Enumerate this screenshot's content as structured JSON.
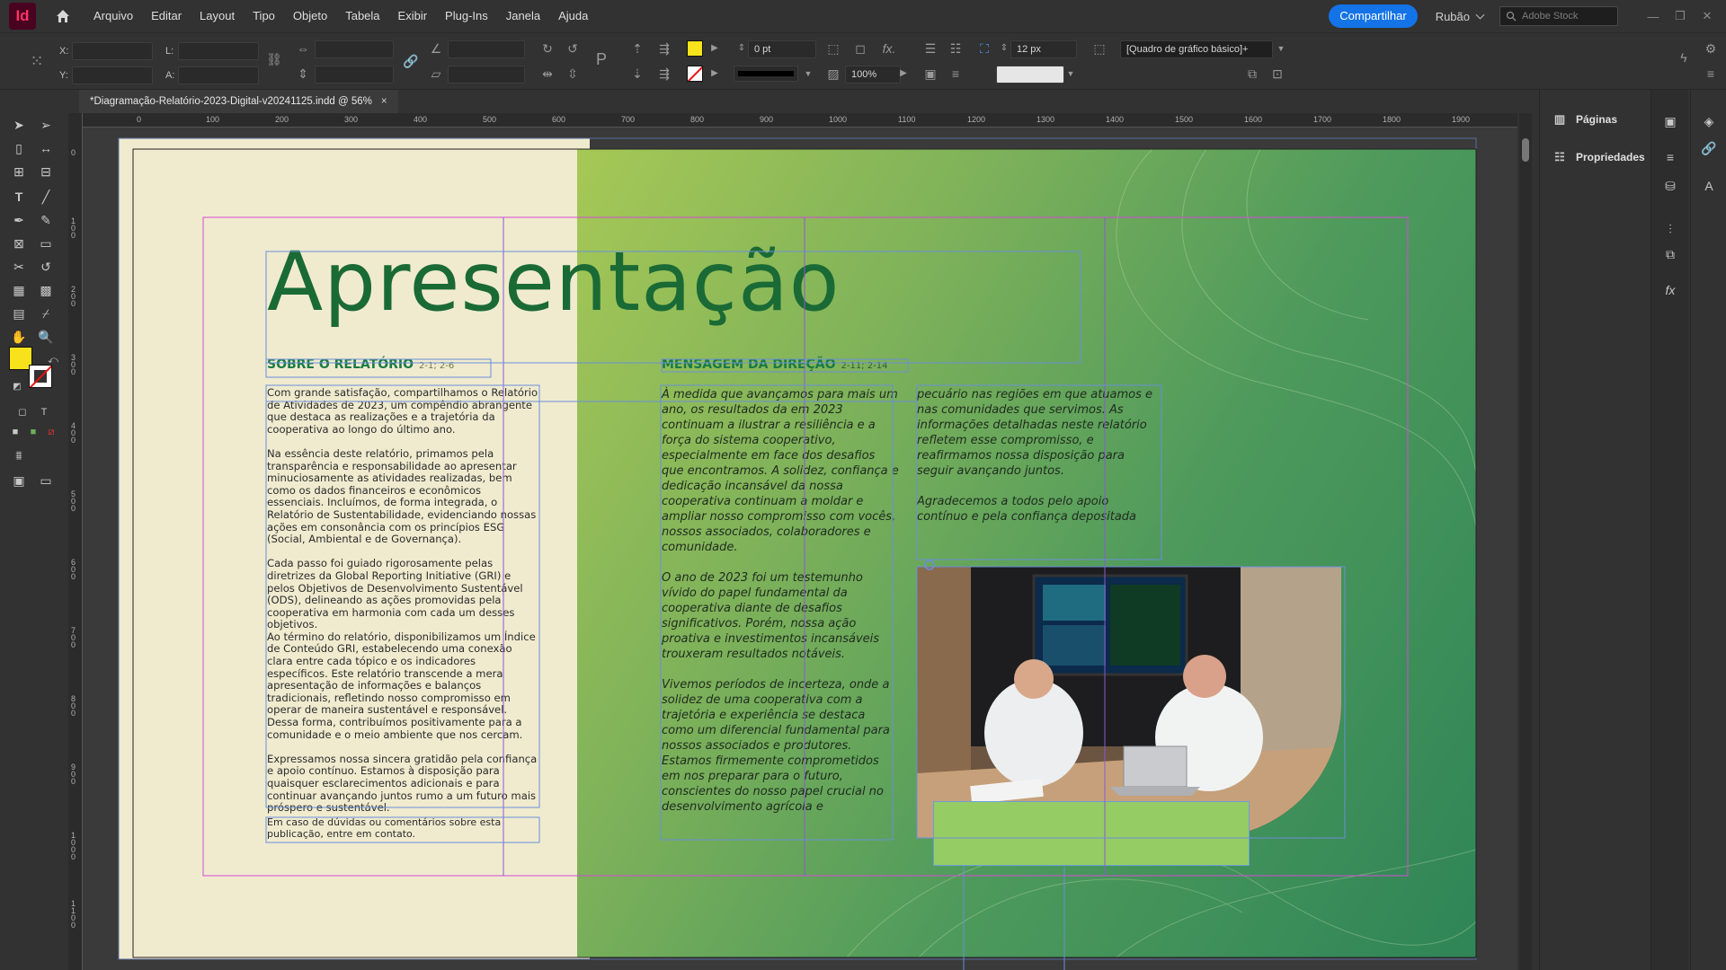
{
  "app": {
    "logo": "Id",
    "menus": [
      "Arquivo",
      "Editar",
      "Layout",
      "Tipo",
      "Objeto",
      "Tabela",
      "Exibir",
      "Plug-Ins",
      "Janela",
      "Ajuda"
    ]
  },
  "header_right": {
    "share_label": "Compartilhar",
    "user": "Rubão",
    "stock_placeholder": "Adobe Stock"
  },
  "control_bar": {
    "x_label": "X:",
    "y_label": "Y:",
    "l_label": "L:",
    "a_label": "A:",
    "stroke_weight": "0 pt",
    "opacity": "100%",
    "gap": "12 px",
    "frame_style": "[Quadro de gráfico básico]+"
  },
  "document": {
    "tab_title": "*Diagramação-Relatório-2023-Digital-v20241125.indd @ 56%",
    "close_symbol": "×"
  },
  "ruler": {
    "h_ticks": [
      "0",
      "100",
      "200",
      "300",
      "400",
      "500",
      "600",
      "700",
      "800",
      "900",
      "1000",
      "1100",
      "1200",
      "1300",
      "1400",
      "1500",
      "1600",
      "1700",
      "1800",
      "1900"
    ],
    "v_ticks": [
      "0",
      "1 0 0",
      "2 0 0",
      "3 0 0",
      "4 0 0",
      "5 0 0",
      "6 0 0",
      "7 0 0",
      "8 0 0",
      "9 0 0",
      "1 0 0 0",
      "1 1 0 0"
    ]
  },
  "page": {
    "title": "Apresentação",
    "section1_heading": "SOBRE O RELATÓRIO",
    "section1_ref": "2-1; 2-6",
    "section2_heading": "MENSAGEM DA DIREÇÃO",
    "section2_ref": "2-11; 2-14",
    "left_paragraphs": [
      "Com grande satisfação, compartilhamos o Relatório de Atividades de 2023, um compêndio abrangente que destaca as realizações e a trajetória da cooperativa ao longo do último ano.",
      "Na essência deste relatório, primamos pela transparência e responsabilidade ao apresentar minuciosamente as atividades realizadas, bem como os dados financeiros e econômicos essenciais. Incluímos, de forma integrada, o Relatório de Sustentabilidade, evidenciando nossas ações em consonância com os princípios ESG (Social, Ambiental e de Governança).",
      "Cada passo foi guiado rigorosamente pelas diretrizes da Global Reporting Initiative (GRI) e pelos Objetivos de Desenvolvimento Sustentável (ODS), delineando as ações promovidas pela cooperativa em harmonia com cada um desses objetivos.",
      "Ao término do relatório, disponibilizamos um Índice de Conteúdo GRI, estabelecendo uma conexão clara entre cada tópico e os indicadores específicos. Este relatório transcende a mera apresentação de informações e balanços tradicionais, refletindo nosso compromisso em operar de maneira sustentável e responsável. Dessa forma, contribuímos positivamente para a comunidade e o meio ambiente que nos cercam.",
      "Expressamos nossa sincera gratidão pela confiança e apoio contínuo. Estamos à disposição para quaisquer esclarecimentos adicionais e para continuar avançando juntos rumo a um futuro mais próspero e sustentável."
    ],
    "contact_note": "Em caso de dúvidas ou comentários sobre esta publicação, entre em contato.",
    "middle_paragraphs": [
      "À medida que avançamos para mais um ano, os resultados da em 2023 continuam a ilustrar a resiliência e a força do sistema cooperativo, especialmente em face dos desafios que encontramos. A solidez, confiança e dedicação incansável da nossa cooperativa continuam a moldar e ampliar nosso compromisso com vocês, nossos associados, colaboradores e comunidade.",
      "O ano de 2023 foi um testemunho vívido do papel fundamental da cooperativa diante de desafios significativos. Porém, nossa ação proativa e investimentos incansáveis trouxeram resultados notáveis.",
      "Vivemos períodos de incerteza, onde a solidez de uma cooperativa com a trajetória e experiência se destaca como um diferencial fundamental para nossos associados e produtores. Estamos firmemente comprometidos em nos preparar para o futuro, conscientes do nosso papel crucial no desenvolvimento agrícola e"
    ],
    "right_paragraphs": [
      "pecuário nas regiões em que atuamos e nas comunidades que servimos. As informações detalhadas neste relatório refletem esse compromisso, e reafirmamos nossa disposição para seguir avançando juntos.",
      "Agradecemos a todos pelo apoio contínuo e pela confiança depositada"
    ]
  },
  "panels": {
    "pages": "Páginas",
    "properties": "Propriedades"
  },
  "colors": {
    "accent": "#1473e6",
    "title_green": "#1a6a35",
    "heading_green": "#197a46",
    "fill": "#f8e21b",
    "page_cream": "#f0ebcf",
    "rect_green": "#96cc64"
  }
}
